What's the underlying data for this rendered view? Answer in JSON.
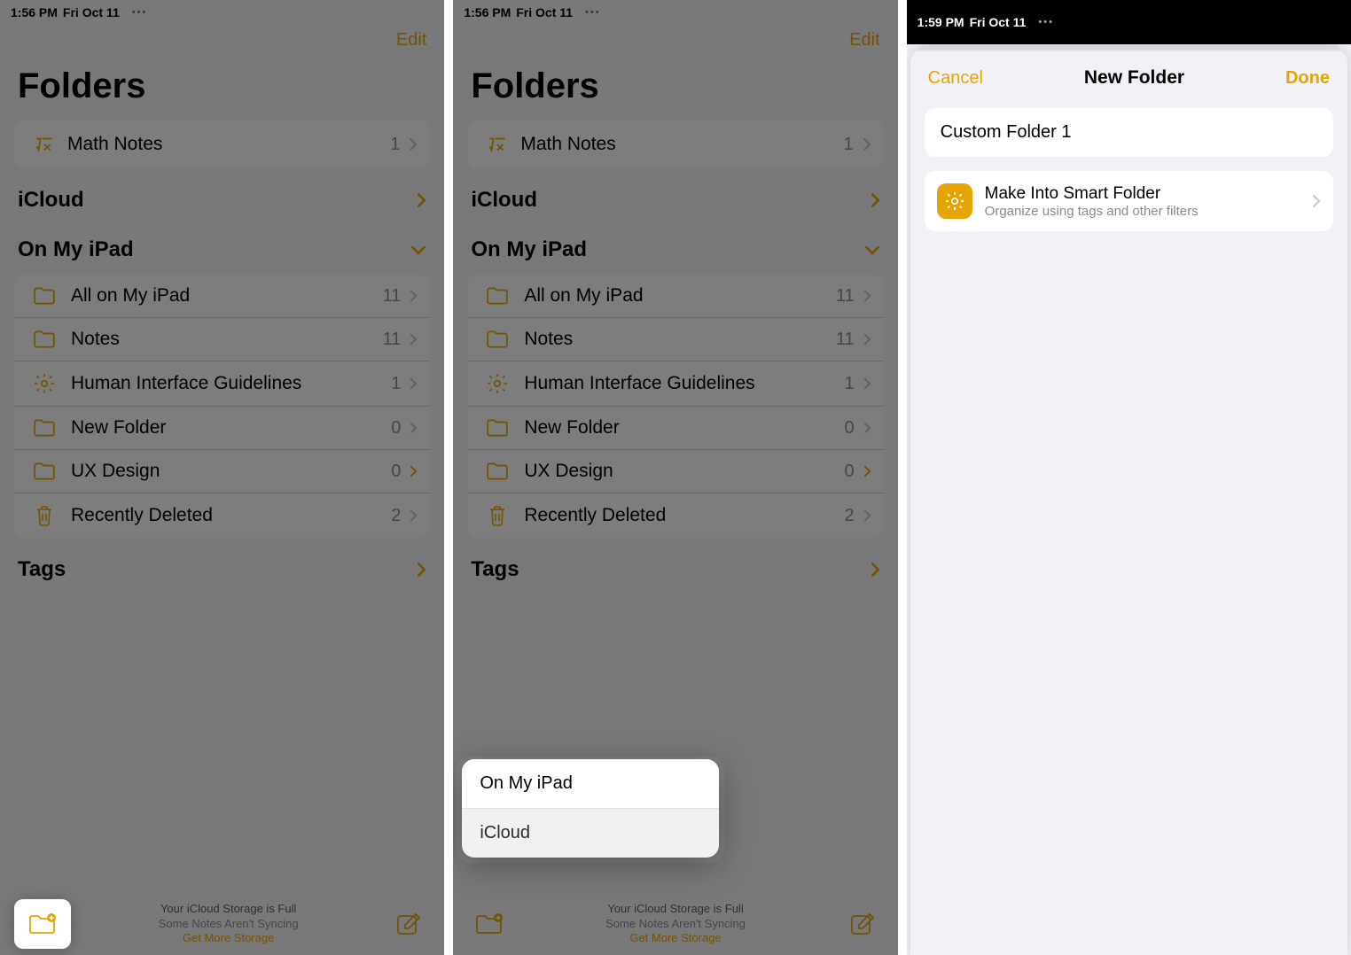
{
  "status": {
    "time12": "1:56 PM",
    "time3": "1:59 PM",
    "date": "Fri Oct 11",
    "dots": "•••"
  },
  "header": {
    "edit": "Edit"
  },
  "title": "Folders",
  "mathNotes": {
    "label": "Math Notes",
    "count": "1"
  },
  "sections": {
    "icloud": "iCloud",
    "onmyipad": "On My iPad",
    "tags": "Tags"
  },
  "folders": [
    {
      "label": "All on My iPad",
      "count": "11",
      "icon": "folder"
    },
    {
      "label": "Notes",
      "count": "11",
      "icon": "folder"
    },
    {
      "label": "Human Interface Guidelines",
      "count": "1",
      "icon": "gear"
    },
    {
      "label": "New Folder",
      "count": "0",
      "icon": "folder"
    },
    {
      "label": "UX Design",
      "count": "0",
      "icon": "folder",
      "yellow": true
    },
    {
      "label": "Recently Deleted",
      "count": "2",
      "icon": "trash"
    }
  ],
  "footer": {
    "line1": "Your iCloud Storage is Full",
    "line2": "Some Notes Aren't Syncing",
    "link": "Get More Storage"
  },
  "popup": {
    "opt1": "On My iPad",
    "opt2": "iCloud"
  },
  "modal": {
    "cancel": "Cancel",
    "title": "New Folder",
    "done": "Done",
    "input": "Custom Folder 1",
    "smartTitle": "Make Into Smart Folder",
    "smartSub": "Organize using tags and other filters"
  }
}
